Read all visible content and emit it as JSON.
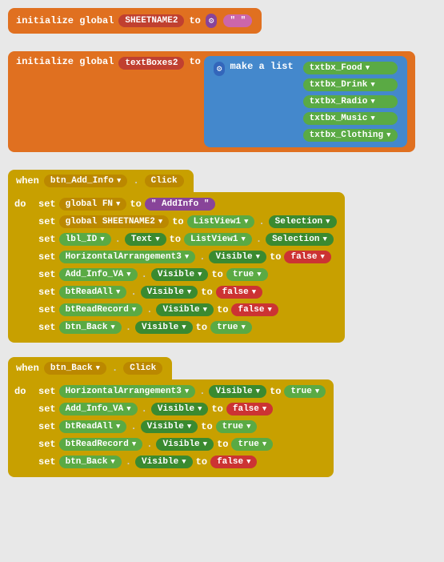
{
  "blocks": {
    "init1": {
      "label": "initialize global",
      "varName": "SHEETNAME2",
      "to": "to",
      "value": ""
    },
    "init2": {
      "label": "initialize global",
      "varName": "textBoxes2",
      "to": "to",
      "makeList": "make a list",
      "items": [
        "txtbx_Food",
        "txtbx_Drink",
        "txtbx_Radio",
        "txtbx_Music",
        "txtbx_Clothing"
      ]
    },
    "when1": {
      "when": "when",
      "component": "btn_Add_Info",
      "event": "Click",
      "do": "do",
      "rows": [
        {
          "set": "set",
          "var": "global FN",
          "to": "to",
          "dot": "",
          "prop": "",
          "value": "AddInfo",
          "valueType": "string"
        },
        {
          "set": "set",
          "var": "global SHEETNAME2",
          "to": "to",
          "component": "ListView1",
          "dot": ".",
          "prop": "Selection",
          "propType": "selection"
        },
        {
          "set": "set",
          "var": "lbl_ID",
          "to": "to",
          "dot": ".",
          "prop1": "Text",
          "component2": "ListView1",
          "dot2": ".",
          "prop2": "Selection"
        },
        {
          "set": "set",
          "var": "HorizontalArrangement3",
          "dot": ".",
          "prop": "Visible",
          "to": "to",
          "value": "false"
        },
        {
          "set": "set",
          "var": "Add_Info_VA",
          "dot": ".",
          "prop": "Visible",
          "to": "to",
          "value": "true"
        },
        {
          "set": "set",
          "var": "btReadAll",
          "dot": ".",
          "prop": "Visible",
          "to": "to",
          "value": "false"
        },
        {
          "set": "set",
          "var": "btReadRecord",
          "dot": ".",
          "prop": "Visible",
          "to": "to",
          "value": "false"
        },
        {
          "set": "set",
          "var": "btn_Back",
          "dot": ".",
          "prop": "Visible",
          "to": "to",
          "value": "true"
        }
      ]
    },
    "when2": {
      "when": "when",
      "component": "btn_Back",
      "event": "Click",
      "do": "do",
      "rows": [
        {
          "set": "set",
          "var": "HorizontalArrangement3",
          "dot": ".",
          "prop": "Visible",
          "to": "to",
          "value": "true"
        },
        {
          "set": "set",
          "var": "Add_Info_VA",
          "dot": ".",
          "prop": "Visible",
          "to": "to",
          "value": "false"
        },
        {
          "set": "set",
          "var": "btReadAll",
          "dot": ".",
          "prop": "Visible",
          "to": "to",
          "value": "true"
        },
        {
          "set": "set",
          "var": "btReadRecord",
          "dot": ".",
          "prop": "Visible",
          "to": "to",
          "value": "true"
        },
        {
          "set": "set",
          "var": "btn_Back",
          "dot": ".",
          "prop": "Visible",
          "to": "to",
          "value": "false"
        }
      ]
    }
  }
}
